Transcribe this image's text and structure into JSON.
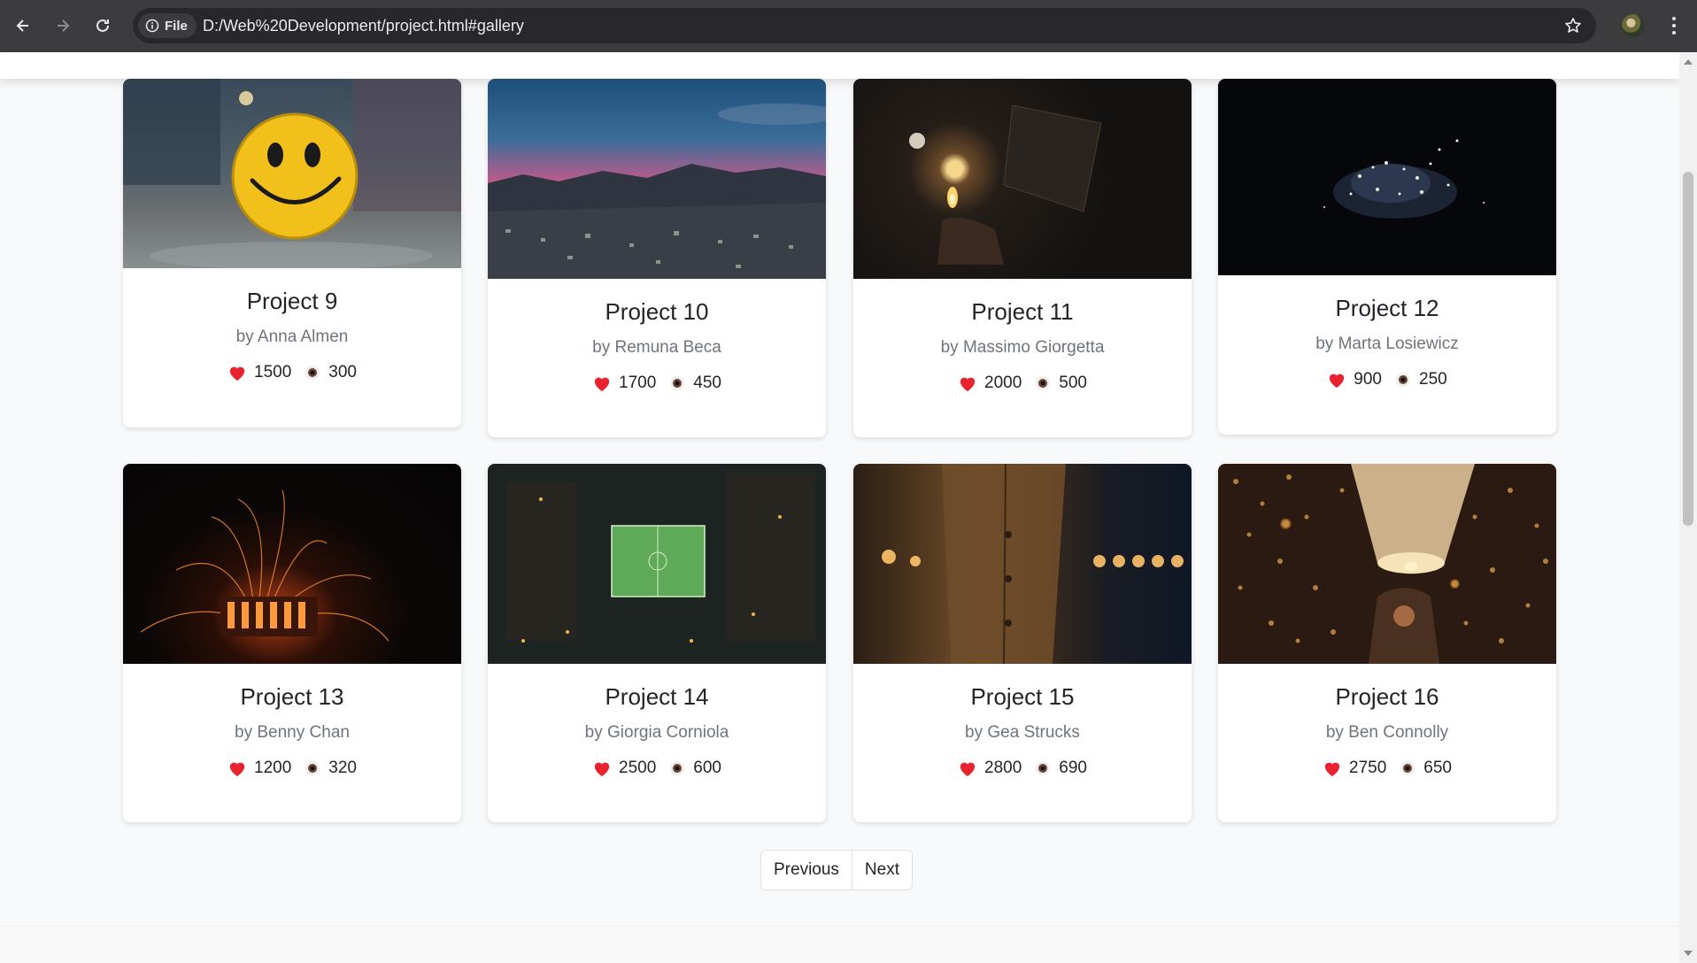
{
  "browser": {
    "site_chip_label": "File",
    "url": "D:/Web%20Development/project.html#gallery"
  },
  "projects": [
    {
      "title": "Project 9",
      "author": "by Anna Almen",
      "likes": "1500",
      "views": "300"
    },
    {
      "title": "Project 10",
      "author": "by Remuna Beca",
      "likes": "1700",
      "views": "450"
    },
    {
      "title": "Project 11",
      "author": "by Massimo Giorgetta",
      "likes": "2000",
      "views": "500"
    },
    {
      "title": "Project 12",
      "author": "by Marta Losiewicz",
      "likes": "900",
      "views": "250"
    },
    {
      "title": "Project 13",
      "author": "by Benny Chan",
      "likes": "1200",
      "views": "320"
    },
    {
      "title": "Project 14",
      "author": "by Giorgia Corniola",
      "likes": "2500",
      "views": "600"
    },
    {
      "title": "Project 15",
      "author": "by Gea Strucks",
      "likes": "2800",
      "views": "690"
    },
    {
      "title": "Project 16",
      "author": "by Ben Connolly",
      "likes": "2750",
      "views": "650"
    }
  ],
  "pagination": {
    "previous": "Previous",
    "next": "Next"
  },
  "colors": {
    "heart": "#e8232f",
    "eye": "#5a3a2a"
  }
}
